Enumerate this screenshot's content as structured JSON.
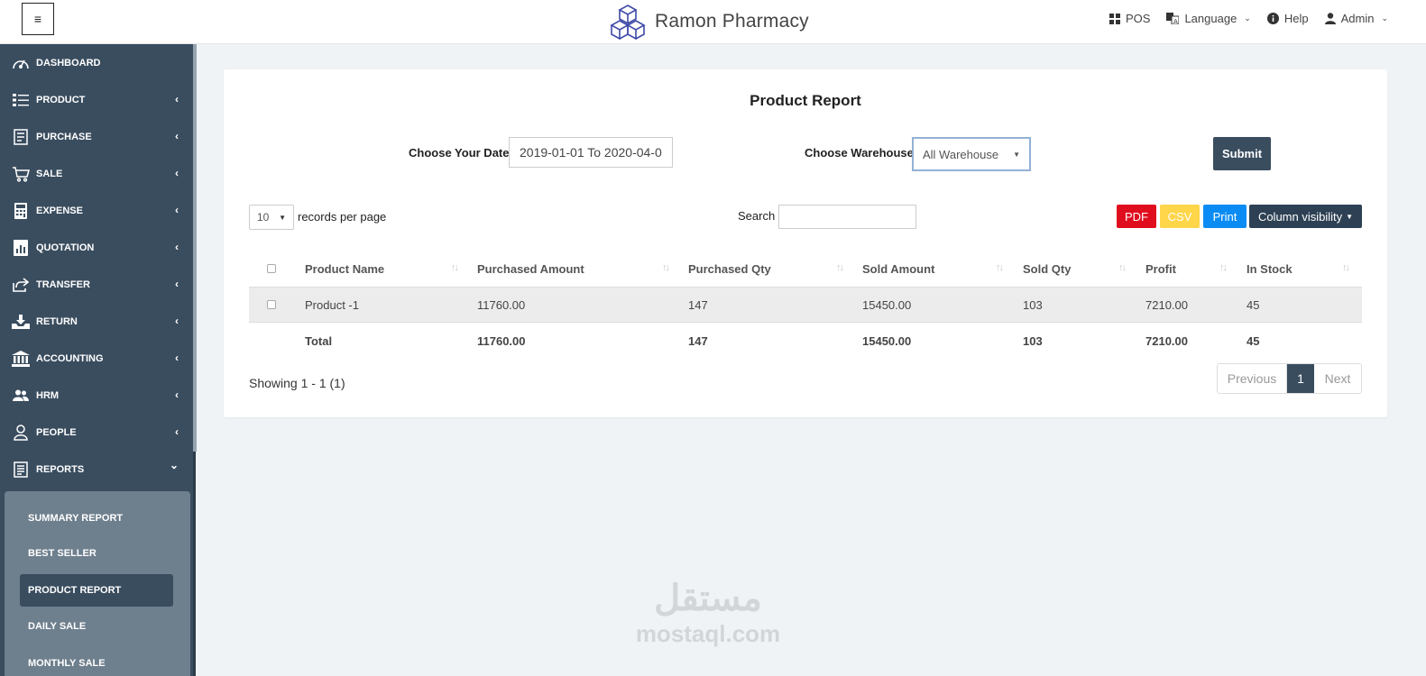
{
  "topbar": {
    "menu_glyph": "≡",
    "app_name": "Ramon Pharmacy",
    "pos": "POS",
    "language": "Language",
    "help": "Help",
    "user": "Admin"
  },
  "sidebar": {
    "items": [
      {
        "label": "DASHBOARD",
        "icon": "dashboard-icon"
      },
      {
        "label": "PRODUCT",
        "icon": "list-icon"
      },
      {
        "label": "PURCHASE",
        "icon": "receipt-icon"
      },
      {
        "label": "SALE",
        "icon": "cart-icon"
      },
      {
        "label": "EXPENSE",
        "icon": "calculator-icon"
      },
      {
        "label": "QUOTATION",
        "icon": "document-chart-icon"
      },
      {
        "label": "TRANSFER",
        "icon": "share-icon"
      },
      {
        "label": "RETURN",
        "icon": "download-tray-icon"
      },
      {
        "label": "ACCOUNTING",
        "icon": "bank-icon"
      },
      {
        "label": "HRM",
        "icon": "users-icon"
      },
      {
        "label": "PEOPLE",
        "icon": "user-icon"
      },
      {
        "label": "REPORTS",
        "icon": "report-icon"
      }
    ],
    "reports_submenu": [
      "SUMMARY REPORT",
      "BEST SELLER",
      "PRODUCT REPORT",
      "DAILY SALE",
      "MONTHLY SALE"
    ],
    "active_sub": "PRODUCT REPORT"
  },
  "report": {
    "title": "Product Report",
    "date_label": "Choose Your Date",
    "date_value": "2019-01-01 To 2020-04-0",
    "warehouse_label": "Choose Warehouse",
    "warehouse_value": "All Warehouse",
    "submit_label": "Submit"
  },
  "table_controls": {
    "per_page": "10",
    "per_page_label": "records per page",
    "search_label": "Search",
    "search_value": "",
    "buttons": {
      "pdf": "PDF",
      "csv": "CSV",
      "print": "Print",
      "colvis": "Column visibility"
    }
  },
  "table": {
    "columns": [
      "Product Name",
      "Purchased Amount",
      "Purchased Qty",
      "Sold Amount",
      "Sold Qty",
      "Profit",
      "In Stock"
    ],
    "rows": [
      [
        "Product -1",
        "11760.00",
        "147",
        "15450.00",
        "103",
        "7210.00",
        "45"
      ]
    ],
    "footer": [
      "Total",
      "11760.00",
      "147",
      "15450.00",
      "103",
      "7210.00",
      "45"
    ]
  },
  "pagination": {
    "info": "Showing 1 - 1 (1)",
    "previous": "Previous",
    "current": "1",
    "next": "Next"
  },
  "watermark": {
    "arabic": "مستقل",
    "latin": "mostaql.com"
  },
  "colors": {
    "sidebar": "#3a4d5f",
    "submenu": "#6e7f8d",
    "pdf": "#e00d1f",
    "csv": "#ffd54a",
    "print": "#0b8cf5"
  }
}
